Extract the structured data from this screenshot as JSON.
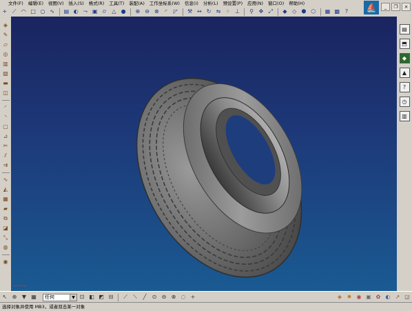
{
  "menu": {
    "items": [
      "文件(F)",
      "编辑(E)",
      "视图(V)",
      "插入(S)",
      "格式(R)",
      "工具(T)",
      "装配(A)",
      "工作坐标系(W)",
      "信息(I)",
      "分析(L)",
      "预设置(P)",
      "应用(N)",
      "窗口(O)",
      "帮助(H)"
    ]
  },
  "toolbar": {
    "select_value": "任何"
  },
  "viewport": {
    "status_text": "********"
  },
  "statusbar": {
    "prompt": "选择对象并使用 MB3，或者双击某一对象"
  },
  "colors": {
    "viewport_top": "#1a2460",
    "viewport_bottom": "#1a5a92",
    "tire": "#6e6e6e"
  }
}
